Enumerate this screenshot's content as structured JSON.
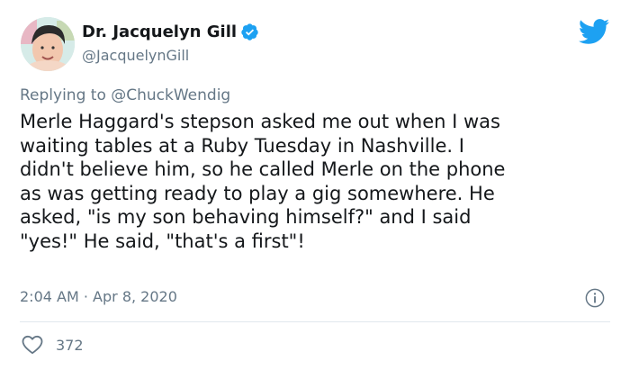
{
  "author": {
    "display_name": "Dr. Jacquelyn Gill",
    "handle": "@JacquelynGill",
    "verified": true
  },
  "reply": {
    "prefix": "Replying to",
    "mention": "@ChuckWendig"
  },
  "body_lines": [
    "Merle Haggard's stepson asked me out when I was",
    "waiting tables at a Ruby Tuesday in Nashville. I",
    "didn't believe him, so he called Merle on the phone",
    "as was getting ready to play a gig somewhere. He",
    "asked, \"is my son behaving himself?\" and I said",
    "\"yes!\" He said, \"that's a first\"!"
  ],
  "meta": {
    "time": "2:04 AM",
    "separator": "·",
    "date": "Apr 8, 2020"
  },
  "likes": {
    "count": "372"
  },
  "icons": {
    "logo": "twitter-bird-icon",
    "verified": "verified-badge-icon",
    "info": "info-icon",
    "like": "heart-icon"
  },
  "colors": {
    "twitter_blue": "#1da1f2",
    "text_primary": "#14171a",
    "text_secondary": "#657786",
    "divider": "#e1e8ed"
  }
}
